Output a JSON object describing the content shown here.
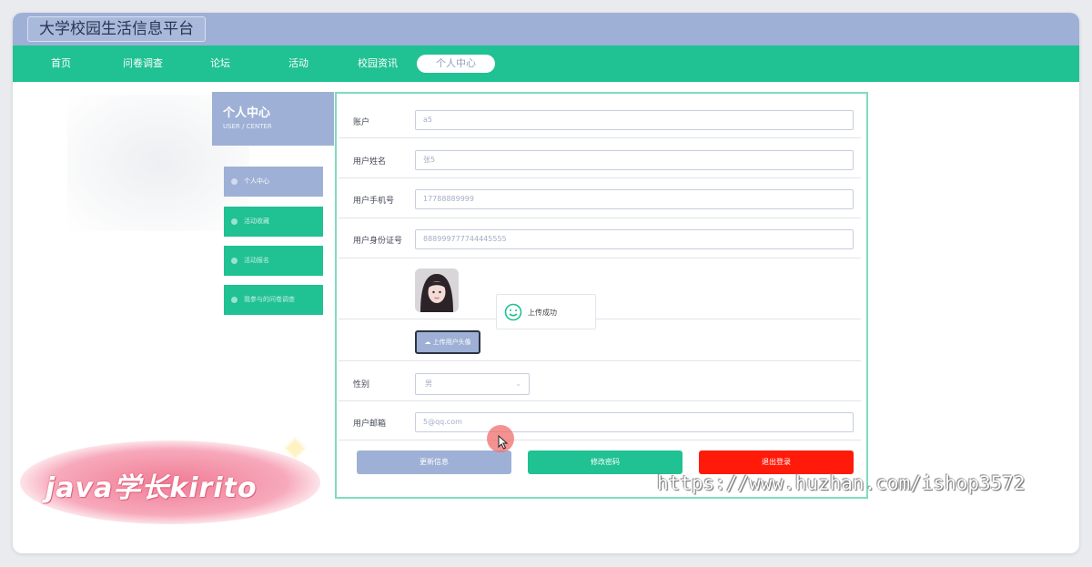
{
  "app": {
    "title": "大学校园生活信息平台"
  },
  "nav": {
    "items": [
      {
        "label": "首页"
      },
      {
        "label": "问卷调查"
      },
      {
        "label": "论坛"
      },
      {
        "label": "活动"
      },
      {
        "label": "校园资讯"
      },
      {
        "label": "个人中心",
        "active": true
      }
    ]
  },
  "sidebar": {
    "title": "个人中心",
    "subtitle": "USER / CENTER",
    "items": [
      {
        "label": "个人中心",
        "active": true
      },
      {
        "label": "活动收藏"
      },
      {
        "label": "活动报名"
      },
      {
        "label": "我参与的问卷调查"
      }
    ]
  },
  "form": {
    "account": {
      "label": "账户",
      "value": "a5"
    },
    "name": {
      "label": "用户姓名",
      "value": "张5"
    },
    "phone": {
      "label": "用户手机号",
      "value": "17788889999"
    },
    "idcard": {
      "label": "用户身份证号",
      "value": "888999777744445555"
    },
    "upload_label": "上传用户头像",
    "gender": {
      "label": "性别",
      "value": "男"
    },
    "email": {
      "label": "用户邮箱",
      "value": "5@qq.com"
    }
  },
  "buttons": {
    "update": "更新信息",
    "change_password": "修改密码",
    "logout": "退出登录"
  },
  "toast": {
    "message": "上传成功"
  },
  "watermarks": {
    "left": "java学长kirito",
    "right": "https://www.huzhan.com/ishop3572"
  },
  "colors": {
    "accent_green": "#20c192",
    "accent_blue": "#9eb0d6",
    "danger_red": "#ff1a0a"
  }
}
